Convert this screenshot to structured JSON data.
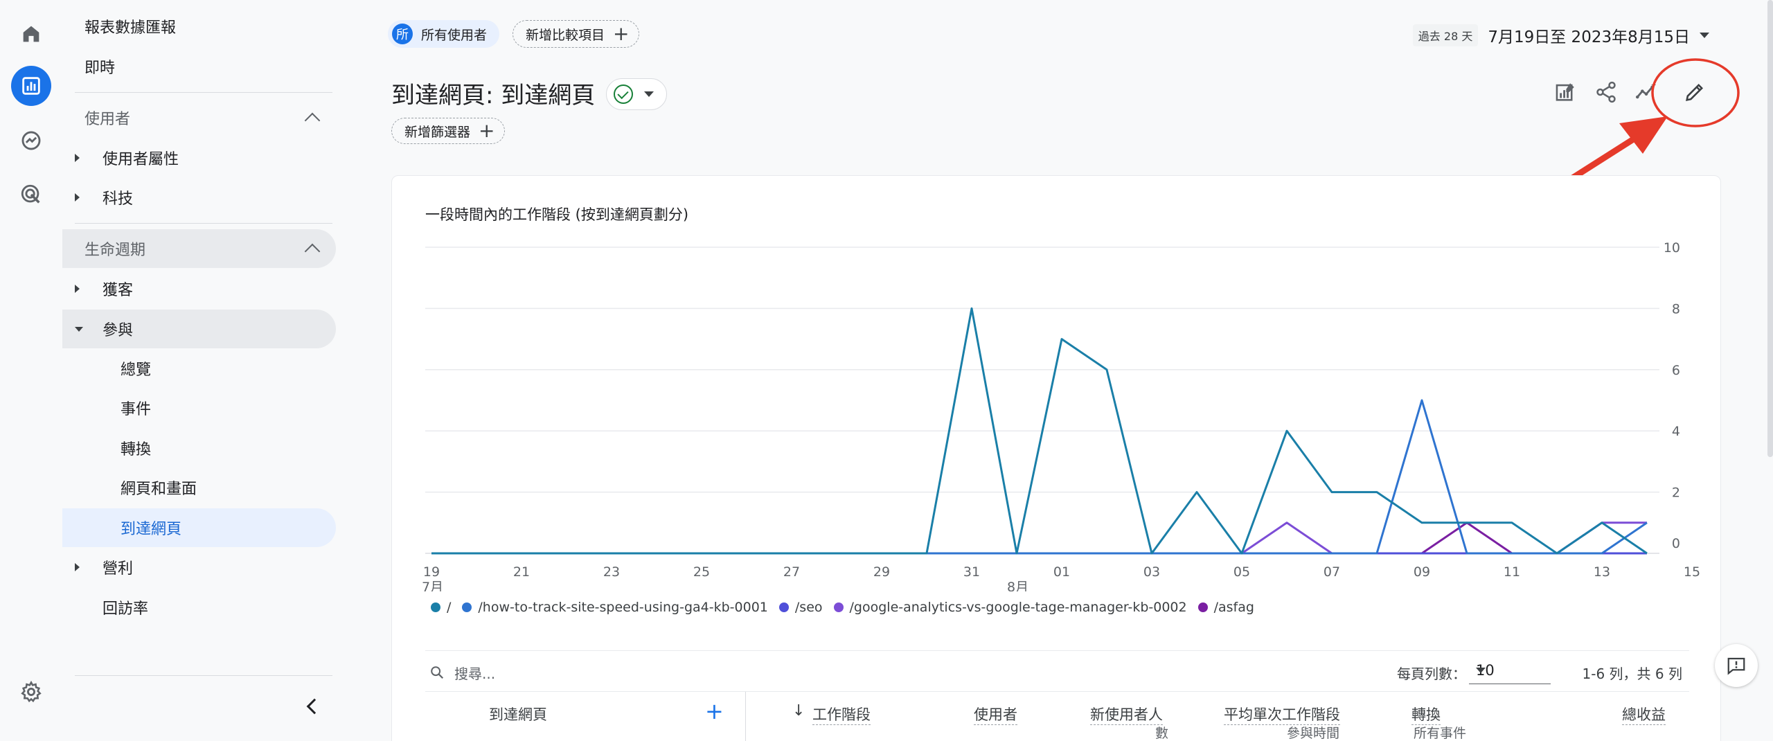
{
  "rail": {
    "items": [
      {
        "icon": "home-icon"
      },
      {
        "icon": "reports-icon",
        "active": true
      },
      {
        "icon": "explore-icon"
      },
      {
        "icon": "advertising-icon"
      },
      {
        "icon": "settings-icon"
      }
    ]
  },
  "nav": {
    "report_snapshot": "報表數據匯報",
    "realtime": "即時",
    "section_users": "使用者",
    "user_attributes": "使用者屬性",
    "tech": "科技",
    "section_lifecycle": "生命週期",
    "acquisition": "獲客",
    "engagement": "參與",
    "overview": "總覽",
    "events": "事件",
    "conversions": "轉換",
    "pages_screens": "網頁和畫面",
    "landing_page": "到達網頁",
    "monetization": "營利",
    "retention": "回訪率"
  },
  "header": {
    "segment_avatar": "所",
    "segment_label": "所有使用者",
    "add_comparison": "新增比較項目",
    "date_badge": "過去 28 天",
    "date_range": "7月19日至 2023年8月15日",
    "title": "到達網頁: 到達網頁",
    "add_filter": "新增篩選器"
  },
  "chart": {
    "title": "一段時間內的工作階段 (按到達網頁劃分)"
  },
  "chart_data": {
    "type": "line",
    "title": "一段時間內的工作階段 (按到達網頁劃分)",
    "x": [
      "7/19",
      "7/20",
      "7/21",
      "7/22",
      "7/23",
      "7/24",
      "7/25",
      "7/26",
      "7/27",
      "7/28",
      "7/29",
      "7/30",
      "7/31",
      "8/01",
      "8/02",
      "8/03",
      "8/04",
      "8/05",
      "8/06",
      "8/07",
      "8/08",
      "8/09",
      "8/10",
      "8/11",
      "8/12",
      "8/13",
      "8/14",
      "8/15"
    ],
    "x_tick_labels": [
      "19",
      "21",
      "23",
      "25",
      "27",
      "29",
      "31",
      "01",
      "03",
      "05",
      "07",
      "09",
      "11",
      "13",
      "15"
    ],
    "x_month_labels": [
      "7月",
      "8月"
    ],
    "y_ticks": [
      "0",
      "2",
      "4",
      "6",
      "8",
      "10"
    ],
    "ylim": [
      0,
      10
    ],
    "grid": true,
    "legend_position": "bottom-left",
    "series": [
      {
        "name": "/",
        "color": "#1a7fa8",
        "values": [
          0,
          0,
          0,
          0,
          0,
          0,
          0,
          0,
          0,
          0,
          0,
          0,
          8,
          0,
          7,
          6,
          0,
          2,
          0,
          4,
          2,
          2,
          1,
          1,
          1,
          0,
          1,
          0
        ]
      },
      {
        "name": "/how-to-track-site-speed-using-ga4-kb-0001",
        "color": "#2f74d0",
        "values": [
          0,
          0,
          0,
          0,
          0,
          0,
          0,
          0,
          0,
          0,
          0,
          0,
          0,
          0,
          0,
          0,
          0,
          0,
          0,
          0,
          0,
          0,
          5,
          0,
          0,
          0,
          0,
          1
        ]
      },
      {
        "name": "/seo",
        "color": "#4f4fd9",
        "values": [
          0,
          0,
          0,
          0,
          0,
          0,
          0,
          0,
          0,
          0,
          0,
          0,
          0,
          0,
          0,
          0,
          0,
          0,
          0,
          0,
          0,
          0,
          0,
          0,
          0,
          0,
          0,
          0
        ]
      },
      {
        "name": "/google-analytics-vs-google-tage-manager-kb-0002",
        "color": "#7c4dd6",
        "values": [
          0,
          0,
          0,
          0,
          0,
          0,
          0,
          0,
          0,
          0,
          0,
          0,
          0,
          0,
          0,
          0,
          0,
          0,
          0,
          1,
          0,
          0,
          0,
          0,
          0,
          0,
          1,
          1
        ]
      },
      {
        "name": "/asfag",
        "color": "#7a1fa2",
        "values": [
          0,
          0,
          0,
          0,
          0,
          0,
          0,
          0,
          0,
          0,
          0,
          0,
          0,
          0,
          0,
          0,
          0,
          0,
          0,
          0,
          0,
          0,
          0,
          1,
          0,
          0,
          0,
          0
        ]
      }
    ]
  },
  "table": {
    "search_placeholder": "搜尋...",
    "rows_per_page_label": "每頁列數：",
    "rows_per_page_value": "10",
    "range_text": "1-6 列，共 6 列",
    "columns": {
      "landing_page": "到達網頁",
      "sessions": "工作階段",
      "users": "使用者",
      "new_users_a": "新使用者人",
      "new_users_b": "數",
      "avg_engagement_a": "平均單次工作階段",
      "avg_engagement_b": "參與時間",
      "conversions": "轉換",
      "conversions_sub": "所有事件",
      "revenue": "總收益"
    }
  }
}
